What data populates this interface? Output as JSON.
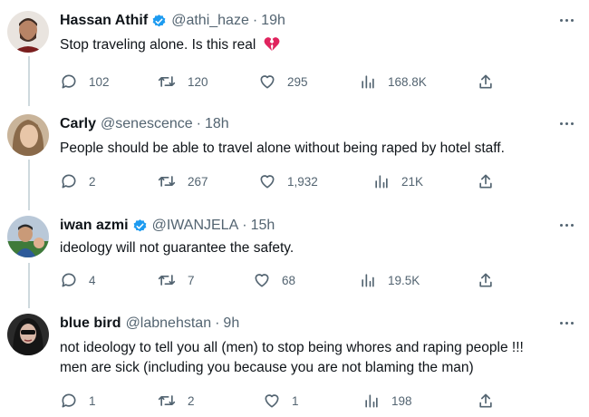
{
  "tweets": [
    {
      "name": "Hassan Athif",
      "verified": true,
      "handle": "@athi_haze",
      "time": "19h",
      "text_lines": [
        "Stop traveling alone. Is this real"
      ],
      "emoji": "broken-heart",
      "replies": "102",
      "retweets": "120",
      "likes": "295",
      "views": "168.8K"
    },
    {
      "name": "Carly",
      "verified": false,
      "handle": "@senescence",
      "time": "18h",
      "text_lines": [
        "People should be able to travel alone without being raped by hotel staff."
      ],
      "replies": "2",
      "retweets": "267",
      "likes": "1,932",
      "views": "21K"
    },
    {
      "name": "iwan azmi",
      "verified": true,
      "handle": "@IWANJELA",
      "time": "15h",
      "text_lines": [
        "ideology will not guarantee the safety."
      ],
      "replies": "4",
      "retweets": "7",
      "likes": "68",
      "views": "19.5K"
    },
    {
      "name": "blue bird",
      "verified": false,
      "handle": "@labnehstan",
      "time": "9h",
      "text_lines": [
        "not ideology to tell you all (men) to stop being whores and raping people !!!",
        "men are sick (including you because you are not blaming the man)"
      ],
      "replies": "1",
      "retweets": "2",
      "likes": "1",
      "views": "198"
    }
  ],
  "separator": "·",
  "icons": {
    "reply": "reply-icon",
    "retweet": "retweet-icon",
    "like": "heart-icon",
    "views": "views-icon",
    "share": "share-icon",
    "verified": "verified-badge-icon",
    "more": "more-options-icon"
  },
  "colors": {
    "verified": "#1d9bf0",
    "text": "#0f1419",
    "secondary": "#536471",
    "thread_line": "#cfd9de",
    "broken_heart": "#e0245e"
  }
}
